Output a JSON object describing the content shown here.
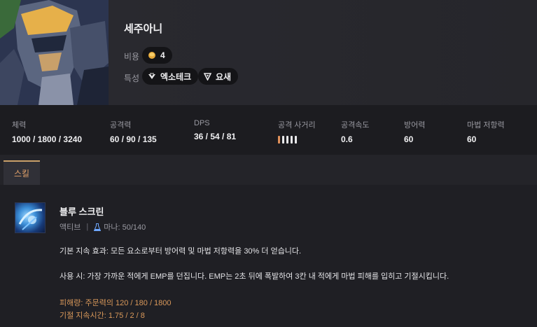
{
  "champion": {
    "name": "세주아니",
    "cost_label": "비용",
    "cost": "4",
    "traits_label": "특성",
    "traits": [
      "엑소테크",
      "요새"
    ]
  },
  "stats": [
    {
      "label": "체력",
      "value": "1000 / 1800 / 3240"
    },
    {
      "label": "공격력",
      "value": "60 / 90 / 135"
    },
    {
      "label": "DPS",
      "value": "36 / 54 / 81"
    },
    {
      "label": "공격 사거리",
      "range_level": 1,
      "range_max": 5
    },
    {
      "label": "공격속도",
      "value": "0.6"
    },
    {
      "label": "방어력",
      "value": "60"
    },
    {
      "label": "마법 저항력",
      "value": "60"
    }
  ],
  "tabs": [
    "스킬"
  ],
  "skill": {
    "name": "블루 스크린",
    "type": "액티브",
    "mana": "마나: 50/140",
    "passive_desc": "기본 지속 효과: 모든 요소로부터 방어력 및 마법 저항력을 30% 더 얻습니다.",
    "active_desc": "사용 시: 가장 가까운 적에게 EMP를 던집니다. EMP는 2초 뒤에 폭발하여 3칸 내 적에게 마법 피해를 입히고 기절시킵니다.",
    "damage": "피해량: 주문력의 120 / 180 / 1800",
    "stun": "기절 지속시간: 1.75 / 2 / 8"
  },
  "colors": {
    "accent": "#e0a06a",
    "scaling": "#d9985a",
    "background": "#1f1f24"
  },
  "icons": {
    "cost": "gold-coin-icon",
    "trait1": "exotech-icon",
    "trait2": "bastion-icon",
    "mana": "mana-flask-icon"
  }
}
